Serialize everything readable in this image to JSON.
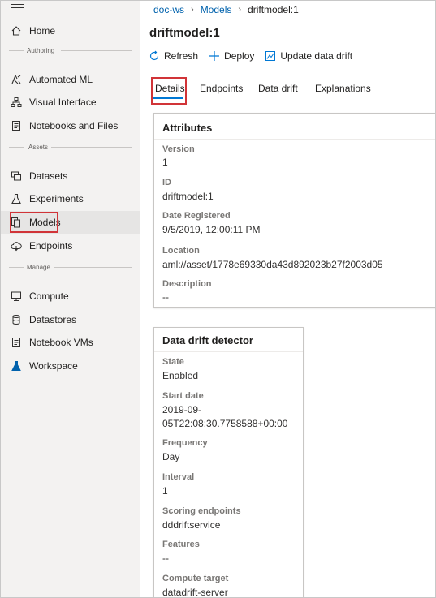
{
  "sidebar": {
    "items": [
      {
        "label": "Home",
        "icon": "home-icon"
      },
      {
        "label": "Automated ML",
        "icon": "automated-ml-icon"
      },
      {
        "label": "Visual Interface",
        "icon": "visual-interface-icon"
      },
      {
        "label": "Notebooks and Files",
        "icon": "notebook-icon"
      },
      {
        "label": "Datasets",
        "icon": "datasets-icon"
      },
      {
        "label": "Experiments",
        "icon": "flask-icon"
      },
      {
        "label": "Models",
        "icon": "models-icon"
      },
      {
        "label": "Endpoints",
        "icon": "cloud-icon"
      },
      {
        "label": "Compute",
        "icon": "monitor-icon"
      },
      {
        "label": "Datastores",
        "icon": "database-icon"
      },
      {
        "label": "Notebook VMs",
        "icon": "notebook-vm-icon"
      },
      {
        "label": "Workspace",
        "icon": "workspace-flask-icon"
      }
    ],
    "sections": {
      "authoring": "Authoring",
      "assets": "Assets",
      "manage": "Manage"
    }
  },
  "breadcrumb": [
    "doc-ws",
    "Models",
    "driftmodel:1"
  ],
  "page_title": "driftmodel:1",
  "toolbar": {
    "refresh": "Refresh",
    "deploy": "Deploy",
    "update_drift": "Update data drift"
  },
  "tabs": [
    "Details",
    "Endpoints",
    "Data drift",
    "Explanations"
  ],
  "attributes": {
    "title": "Attributes",
    "fields": [
      {
        "label": "Version",
        "value": "1"
      },
      {
        "label": "ID",
        "value": "driftmodel:1"
      },
      {
        "label": "Date Registered",
        "value": "9/5/2019, 12:00:11 PM"
      },
      {
        "label": "Location",
        "value": "aml://asset/1778e69330da43d892023b27f2003d05"
      },
      {
        "label": "Description",
        "value": "--"
      }
    ]
  },
  "drift_detector": {
    "title": "Data drift detector",
    "fields": [
      {
        "label": "State",
        "value": "Enabled"
      },
      {
        "label": "Start date",
        "value_lines": [
          "2019-09-",
          "05T22:08:30.7758588+00:00"
        ]
      },
      {
        "label": "Frequency",
        "value": "Day"
      },
      {
        "label": "Interval",
        "value": "1"
      },
      {
        "label": "Scoring endpoints",
        "value": "dddriftservice"
      },
      {
        "label": "Features",
        "value": "--"
      },
      {
        "label": "Compute target",
        "value": "datadrift-server"
      }
    ]
  },
  "colors": {
    "accent": "#0078d4",
    "link": "#0062ad",
    "highlight_box": "#d13438",
    "sidebar_bg": "#f3f2f1"
  }
}
